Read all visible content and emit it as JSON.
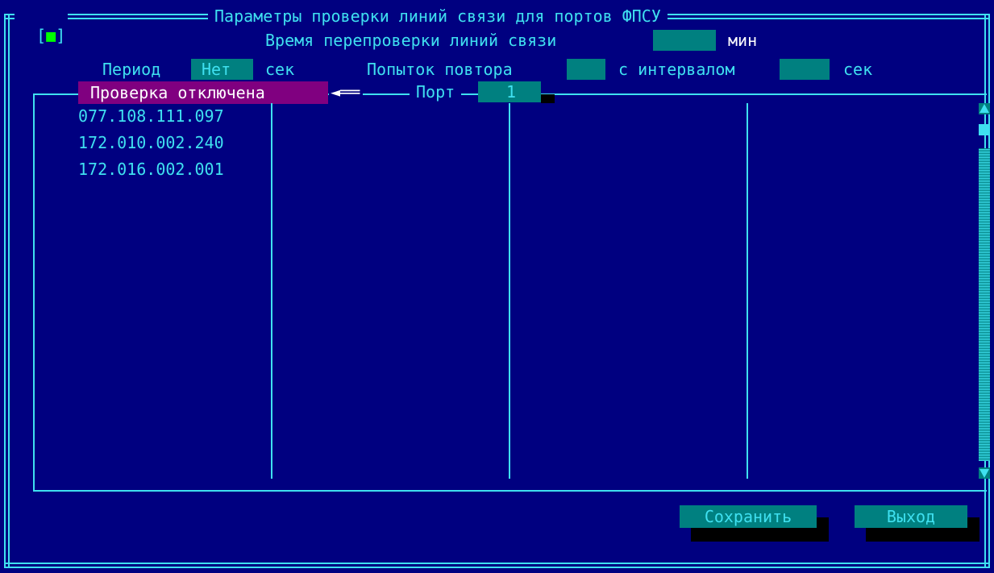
{
  "window": {
    "close_glyph": "■",
    "title": "Параметры проверки линий связи для портов ФПСУ"
  },
  "recheck": {
    "label": "Время перепроверки линий связи",
    "value": "",
    "unit": "мин"
  },
  "period": {
    "label": "Период",
    "value": "Нет",
    "unit": "сек"
  },
  "retries": {
    "label": "Попыток повтора",
    "value": ""
  },
  "interval": {
    "label": "с интервалом",
    "value": "",
    "unit": "сек"
  },
  "status": {
    "text": "Проверка отключена",
    "arrow": "◄══"
  },
  "port": {
    "label": "Порт",
    "value": "1"
  },
  "addresses": [
    "077.108.111.097",
    "172.010.002.240",
    "172.016.002.001"
  ],
  "buttons": {
    "save": "Сохранить",
    "exit": "Выход"
  },
  "colors": {
    "background": "#000080",
    "text": "#3fe0f0",
    "field": "#008080",
    "selected": "#800080",
    "close_box": "#00ff00"
  }
}
